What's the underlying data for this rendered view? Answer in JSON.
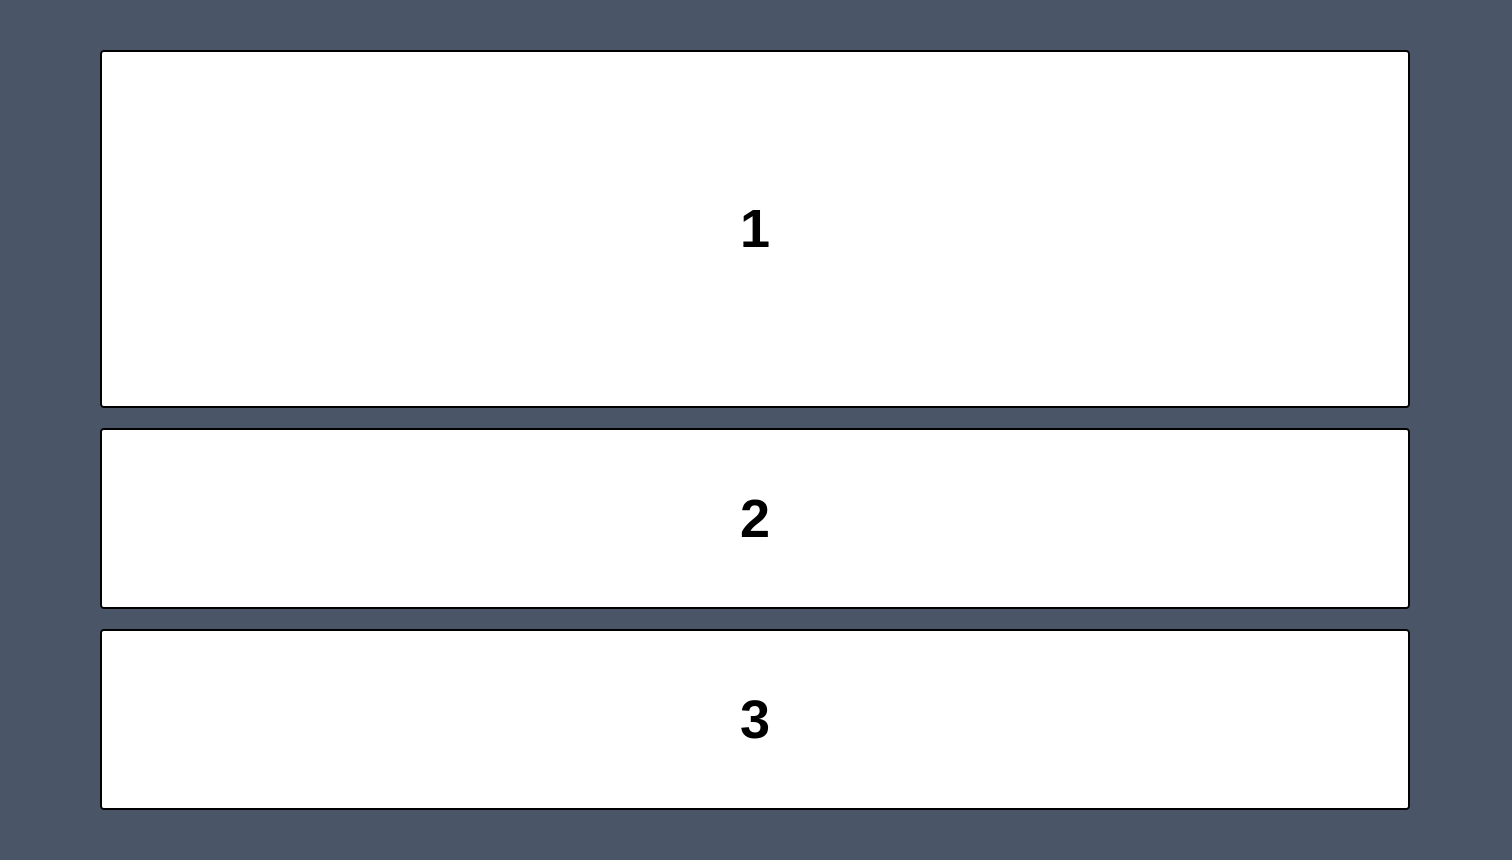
{
  "colors": {
    "background": "#4a5568",
    "panel_background": "#ffffff",
    "panel_border": "#000000",
    "text": "#000000"
  },
  "panels": [
    {
      "label": "1"
    },
    {
      "label": "2"
    },
    {
      "label": "3"
    }
  ]
}
